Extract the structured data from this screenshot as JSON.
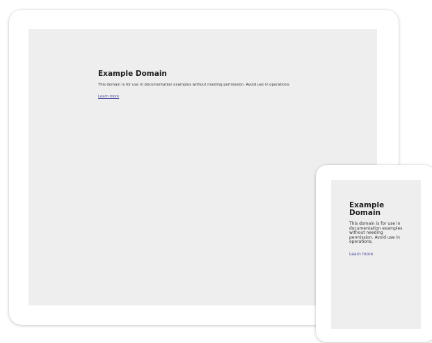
{
  "tablet": {
    "heading": "Example Domain",
    "paragraph": "This domain is for use in documentation examples without needing permission. Avoid use in operations.",
    "link": "Learn more"
  },
  "phone": {
    "heading": "Example Domain",
    "paragraph": "This domain is for use in documentation examples without needing permission. Avoid use in operations.",
    "link": "Learn more"
  },
  "colors": {
    "screen_background": "#eeeeee",
    "frame": "#ffffff",
    "heading_text": "#1e1e1e",
    "body_text": "#333333",
    "link": "#4a4a9c"
  }
}
